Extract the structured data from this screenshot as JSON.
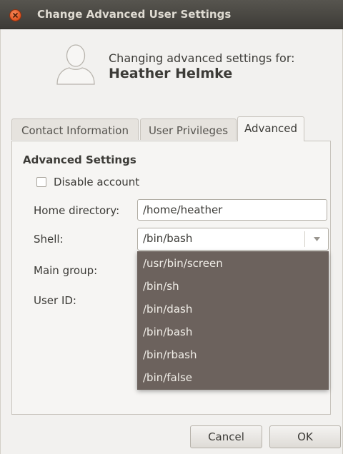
{
  "window": {
    "title": "Change Advanced User Settings"
  },
  "header": {
    "changing_text": "Changing advanced settings for:",
    "user_name": "Heather Helmke"
  },
  "tabs": [
    {
      "label": "Contact Information",
      "active": false
    },
    {
      "label": "User Privileges",
      "active": false
    },
    {
      "label": "Advanced",
      "active": true
    }
  ],
  "advanced": {
    "section_title": "Advanced Settings",
    "disable_account_label": "Disable account",
    "disable_account_checked": false,
    "home_directory_label": "Home directory:",
    "home_directory_value": "/home/heather",
    "shell_label": "Shell:",
    "shell_value": "/bin/bash",
    "main_group_label": "Main group:",
    "user_id_label": "User ID:"
  },
  "shell_options": [
    "/usr/bin/screen",
    "/bin/sh",
    "/bin/dash",
    "/bin/bash",
    "/bin/rbash",
    "/bin/false"
  ],
  "buttons": {
    "cancel": "Cancel",
    "ok": "OK"
  },
  "colors": {
    "titlebar": "#3d3b37",
    "close_button": "#e0531f",
    "dropdown_background": "#6c625d"
  },
  "icons": {
    "close": "close-icon",
    "avatar": "user-avatar-icon",
    "dropdown": "chevron-down-icon"
  }
}
